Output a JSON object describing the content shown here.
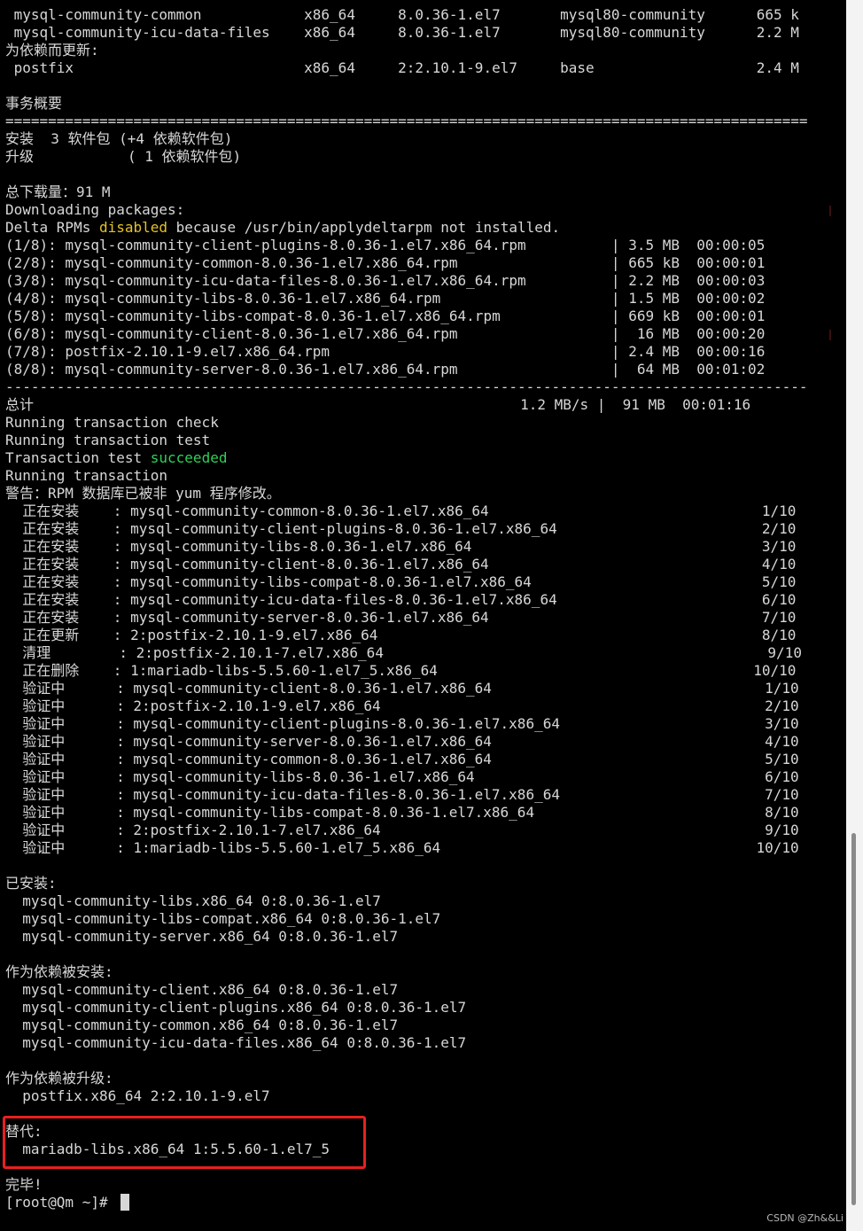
{
  "terminal": {
    "lines": [
      " mysql-community-common            x86_64     8.0.36-1.el7       mysql80-community      665 k",
      " mysql-community-icu-data-files    x86_64     8.0.36-1.el7       mysql80-community      2.2 M",
      "为依赖而更新:",
      " postfix                           x86_64     2:2.10.1-9.el7     base                   2.4 M",
      "",
      "事务概要",
      "==============================================================================================",
      "安装  3 软件包 (+4 依赖软件包)",
      "升级           ( 1 依赖软件包)",
      "",
      "总下载量：91 M",
      "Downloading packages:",
      "Delta RPMs disabled because /usr/bin/applydeltarpm not installed.",
      "(1/8): mysql-community-client-plugins-8.0.36-1.el7.x86_64.rpm          | 3.5 MB  00:00:05",
      "(2/8): mysql-community-common-8.0.36-1.el7.x86_64.rpm                  | 665 kB  00:00:01",
      "(3/8): mysql-community-icu-data-files-8.0.36-1.el7.x86_64.rpm          | 2.2 MB  00:00:03",
      "(4/8): mysql-community-libs-8.0.36-1.el7.x86_64.rpm                    | 1.5 MB  00:00:02",
      "(5/8): mysql-community-libs-compat-8.0.36-1.el7.x86_64.rpm             | 669 kB  00:00:01",
      "(6/8): mysql-community-client-8.0.36-1.el7.x86_64.rpm                  |  16 MB  00:00:20",
      "(7/8): postfix-2.10.1-9.el7.x86_64.rpm                                 | 2.4 MB  00:00:16",
      "(8/8): mysql-community-server-8.0.36-1.el7.x86_64.rpm                  |  64 MB  00:01:02",
      "----------------------------------------------------------------------------------------------",
      "总计                                                         1.2 MB/s |  91 MB  00:01:16",
      "Running transaction check",
      "Running transaction test",
      "Transaction test succeeded",
      "Running transaction",
      "警告：RPM 数据库已被非 yum 程序修改。",
      "  正在安装    : mysql-community-common-8.0.36-1.el7.x86_64                                1/10",
      "  正在安装    : mysql-community-client-plugins-8.0.36-1.el7.x86_64                        2/10",
      "  正在安装    : mysql-community-libs-8.0.36-1.el7.x86_64                                  3/10",
      "  正在安装    : mysql-community-client-8.0.36-1.el7.x86_64                                4/10",
      "  正在安装    : mysql-community-libs-compat-8.0.36-1.el7.x86_64                           5/10",
      "  正在安装    : mysql-community-icu-data-files-8.0.36-1.el7.x86_64                        6/10",
      "  正在安装    : mysql-community-server-8.0.36-1.el7.x86_64                                7/10",
      "  正在更新    : 2:postfix-2.10.1-9.el7.x86_64                                             8/10",
      "  清理        : 2:postfix-2.10.1-7.el7.x86_64                                             9/10",
      "  正在删除    : 1:mariadb-libs-5.5.60-1.el7_5.x86_64                                     10/10",
      "  验证中      : mysql-community-client-8.0.36-1.el7.x86_64                                1/10",
      "  验证中      : 2:postfix-2.10.1-9.el7.x86_64                                             2/10",
      "  验证中      : mysql-community-client-plugins-8.0.36-1.el7.x86_64                        3/10",
      "  验证中      : mysql-community-server-8.0.36-1.el7.x86_64                                4/10",
      "  验证中      : mysql-community-common-8.0.36-1.el7.x86_64                                5/10",
      "  验证中      : mysql-community-libs-8.0.36-1.el7.x86_64                                  6/10",
      "  验证中      : mysql-community-icu-data-files-8.0.36-1.el7.x86_64                        7/10",
      "  验证中      : mysql-community-libs-compat-8.0.36-1.el7.x86_64                           8/10",
      "  验证中      : 2:postfix-2.10.1-7.el7.x86_64                                             9/10",
      "  验证中      : 1:mariadb-libs-5.5.60-1.el7_5.x86_64                                     10/10",
      "",
      "已安装:",
      "  mysql-community-libs.x86_64 0:8.0.36-1.el7",
      "  mysql-community-libs-compat.x86_64 0:8.0.36-1.el7",
      "  mysql-community-server.x86_64 0:8.0.36-1.el7",
      "",
      "作为依赖被安装:",
      "  mysql-community-client.x86_64 0:8.0.36-1.el7",
      "  mysql-community-client-plugins.x86_64 0:8.0.36-1.el7",
      "  mysql-community-common.x86_64 0:8.0.36-1.el7",
      "  mysql-community-icu-data-files.x86_64 0:8.0.36-1.el7",
      "",
      "作为依赖被升级:",
      "  postfix.x86_64 2:2.10.1-9.el7",
      "",
      "替代:",
      "  mariadb-libs.x86_64 1:5.5.60-1.el7_5",
      "",
      "完毕!",
      "[root@Qm ~]# "
    ],
    "delta_prefix": "Delta RPMs ",
    "delta_keyword": "disabled",
    "delta_suffix": " because /usr/bin/applydeltarpm not installed.",
    "tx_prefix": "Transaction test ",
    "tx_keyword": "succeeded",
    "colors": {
      "background": "#000000",
      "foreground": "#d7d7d7",
      "keyword_warning": "#e6c12a",
      "keyword_success": "#2fd05a",
      "highlight_box": "#e8201e"
    }
  },
  "watermark": "CSDN @Zh&&Li"
}
